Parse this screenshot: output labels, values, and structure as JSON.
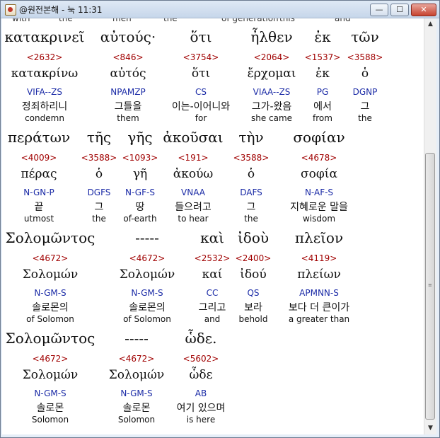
{
  "window": {
    "title": "@원전본해 - 눅 11:31",
    "min_glyph": "—",
    "max_glyph": "☐",
    "close_glyph": "✕"
  },
  "scrollbar": {
    "up_glyph": "▲",
    "down_glyph": "▼",
    "grip_glyph": "≡"
  },
  "top_partial": [
    "with",
    "the",
    "men",
    "the",
    "of generation",
    "this",
    "and"
  ],
  "rows": [
    [
      {
        "greek": "κατακρινεῖ",
        "strong": "<2632>",
        "lemma": "κατακρίνω",
        "parse": "VIFA--ZS",
        "korean": "정죄하리니",
        "english": "condemn"
      },
      {
        "greek": "αὐτούς·",
        "strong": "<846>",
        "lemma": "αὐτός",
        "parse": "NPAMZP",
        "korean": "그들을",
        "english": "them"
      },
      {
        "greek": "ὅτι",
        "strong": "<3754>",
        "lemma": "ὅτι",
        "parse": "CS",
        "korean": "이는-이어니와",
        "english": "for"
      },
      {
        "greek": "ἦλθεν",
        "strong": "<2064>",
        "lemma": "ἔρχομαι",
        "parse": "VIAA--ZS",
        "korean": "그가-왔음",
        "english": "she came"
      },
      {
        "greek": "ἐκ",
        "strong": "<1537>",
        "lemma": "ἐκ",
        "parse": "PG",
        "korean": "에서",
        "english": "from"
      },
      {
        "greek": "τῶν",
        "strong": "<3588>",
        "lemma": "ὁ",
        "parse": "DGNP",
        "korean": "그",
        "english": "the"
      }
    ],
    [
      {
        "greek": "περάτων",
        "strong": "<4009>",
        "lemma": "πέρας",
        "parse": "N-GN-P",
        "korean": "끝",
        "english": "utmost"
      },
      {
        "greek": "τῆς",
        "strong": "<3588>",
        "lemma": "ὁ",
        "parse": "DGFS",
        "korean": "그",
        "english": "the"
      },
      {
        "greek": "γῆς",
        "strong": "<1093>",
        "lemma": "γῆ",
        "parse": "N-GF-S",
        "korean": "땅",
        "english": "of-earth"
      },
      {
        "greek": "ἀκοῦσαι",
        "strong": "<191>",
        "lemma": "ἀκούω",
        "parse": "VNAA",
        "korean": "들으려고",
        "english": "to hear"
      },
      {
        "greek": "τὴν",
        "strong": "<3588>",
        "lemma": "ὁ",
        "parse": "DAFS",
        "korean": "그",
        "english": "the"
      },
      {
        "greek": "σοφίαν",
        "strong": "<4678>",
        "lemma": "σοφία",
        "parse": "N-AF-S",
        "korean": "지혜로운 말을",
        "english": "wisdom"
      }
    ],
    [
      {
        "greek": "Σολομῶντος",
        "strong": "<4672>",
        "lemma": "Σολομών",
        "parse": "N-GM-S",
        "korean": "솔로몬의",
        "english": "of Solomon"
      },
      {
        "greek": "-----",
        "strong": "<4672>",
        "lemma": "Σολομών",
        "parse": "N-GM-S",
        "korean": "솔로몬의",
        "english": "of Solomon"
      },
      {
        "greek": "καὶ",
        "strong": "<2532>",
        "lemma": "καί",
        "parse": "CC",
        "korean": "그리고",
        "english": "and"
      },
      {
        "greek": "ἰδοὺ",
        "strong": "<2400>",
        "lemma": "ἰδού",
        "parse": "QS",
        "korean": "보라",
        "english": "behold"
      },
      {
        "greek": "πλεῖον",
        "strong": "<4119>",
        "lemma": "πλείων",
        "parse": "APMNN-S",
        "korean": "보다 더 큰이가",
        "english": "a greater than"
      }
    ],
    [
      {
        "greek": "Σολομῶντος",
        "strong": "<4672>",
        "lemma": "Σολομών",
        "parse": "N-GM-S",
        "korean": "솔로몬",
        "english": "Solomon"
      },
      {
        "greek": "-----",
        "strong": "<4672>",
        "lemma": "Σολομών",
        "parse": "N-GM-S",
        "korean": "솔로몬",
        "english": "Solomon"
      },
      {
        "greek": "ὧδε.",
        "strong": "<5602>",
        "lemma": "ὧδε",
        "parse": "AB",
        "korean": "여기 있으며",
        "english": "is here"
      }
    ]
  ]
}
